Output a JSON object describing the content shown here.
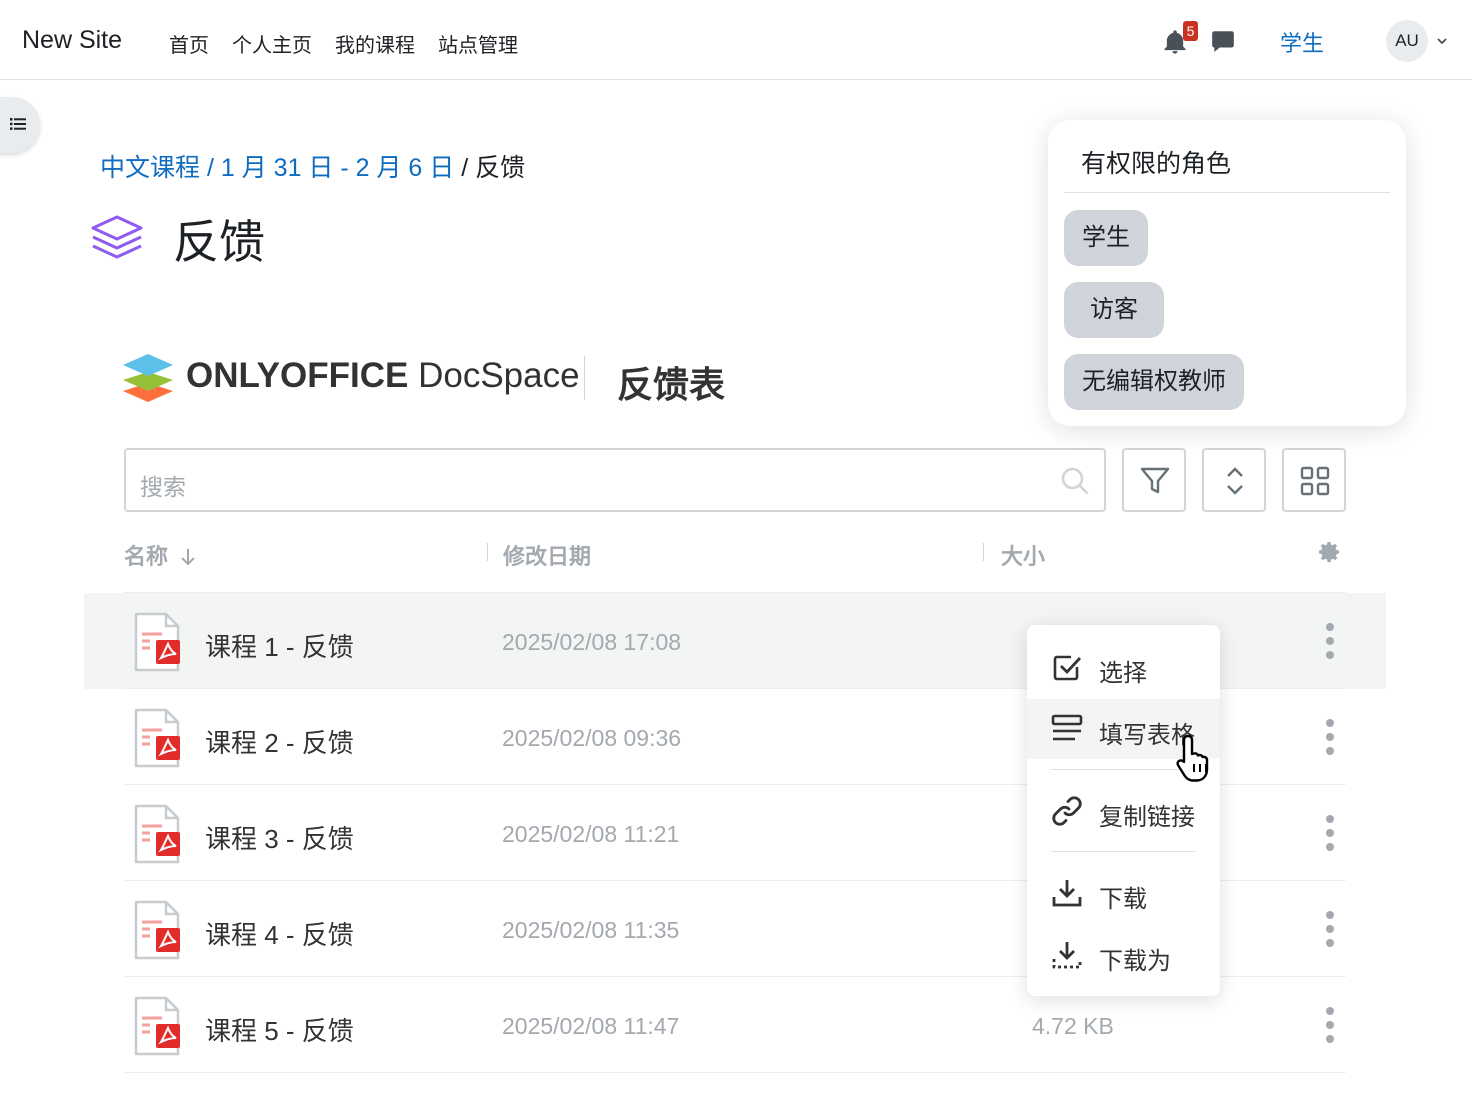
{
  "topbar": {
    "site_name": "New Site",
    "nav": [
      "首页",
      "个人主页",
      "我的课程",
      "站点管理"
    ],
    "notification_count": "5",
    "role": "学生",
    "avatar_initials": "AU"
  },
  "breadcrumb": {
    "items": [
      "中文课程",
      "1 月 31 日 - 2 月 6 日",
      "反馈"
    ],
    "separator": "/"
  },
  "page_title": "反馈",
  "roles_popup": {
    "title": "有权限的角色",
    "roles": [
      "学生",
      "访客",
      "无编辑权教师"
    ]
  },
  "docspace": {
    "brand_bold": "ONLYOFFICE",
    "brand_light": "DocSpace",
    "room_title": "反馈表"
  },
  "search": {
    "placeholder": "搜索"
  },
  "columns": {
    "name": "名称",
    "modified": "修改日期",
    "size": "大小"
  },
  "files": [
    {
      "name": "课程 1 - 反馈",
      "date": "2025/02/08 17:08",
      "size": ""
    },
    {
      "name": "课程 2 - 反馈",
      "date": "2025/02/08 09:36",
      "size": ""
    },
    {
      "name": "课程 3 - 反馈",
      "date": "2025/02/08 11:21",
      "size": ""
    },
    {
      "name": "课程 4 - 反馈",
      "date": "2025/02/08 11:35",
      "size": ""
    },
    {
      "name": "课程 5 - 反馈",
      "date": "2025/02/08 11:47",
      "size": "4.72 KB"
    }
  ],
  "context_menu": {
    "select": "选择",
    "fill_form": "填写表格",
    "copy_link": "复制链接",
    "download": "下载",
    "download_as": "下载为"
  },
  "colors": {
    "link": "#0f6cbf",
    "pdf_red": "#e22c2c",
    "title_icon": "#8f5bf0",
    "muted": "#a3a9ae"
  }
}
